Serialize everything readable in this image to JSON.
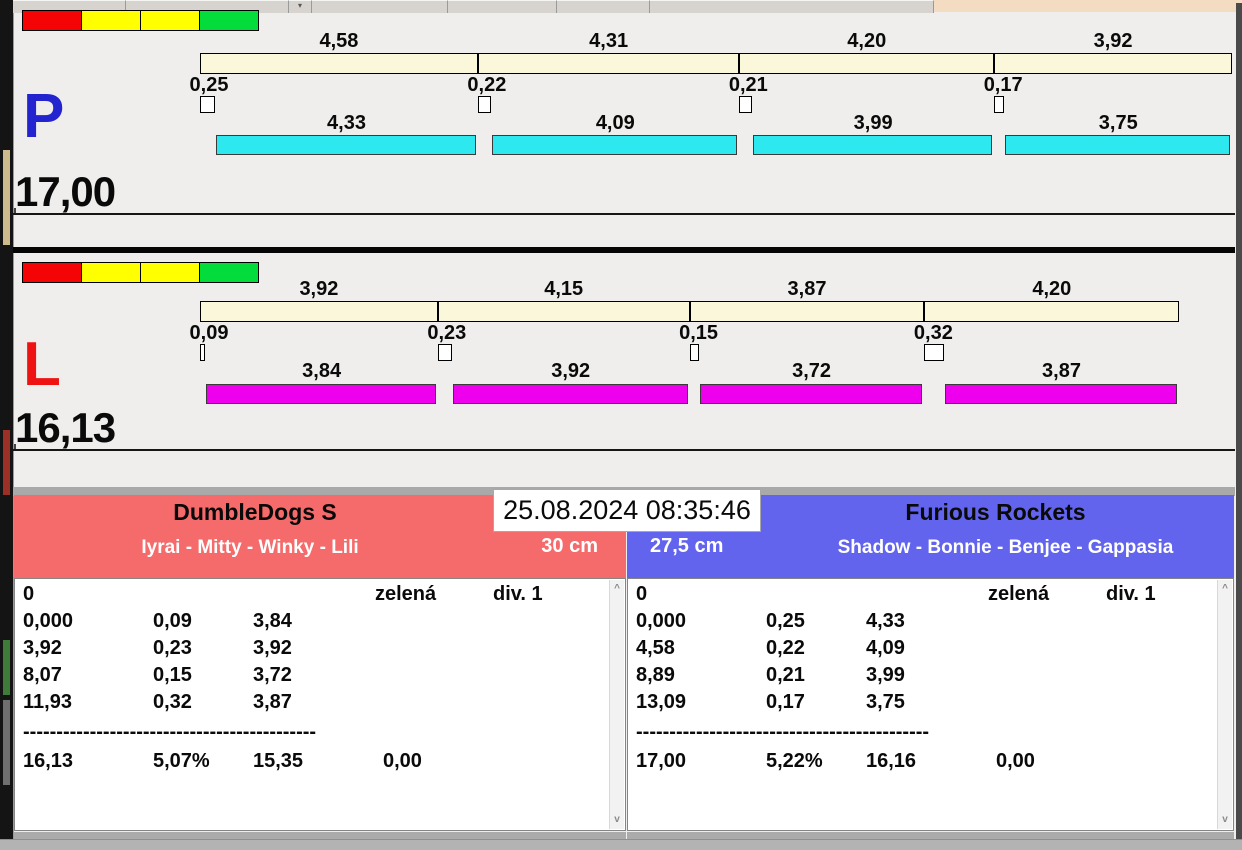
{
  "datetime": "25.08.2024 08:35:46",
  "runs": [
    {
      "letter": "P",
      "letter_color": "#2323cf",
      "total_label": "17,00",
      "total_seconds": 17.0,
      "bar_color": "#2de9ef",
      "legend_colors": [
        "#f40404",
        "#ffff00",
        "#ffff00",
        "#04dc3c"
      ],
      "laps": [
        {
          "split_label": "4,58",
          "split": 4.58,
          "box_label": "0,25",
          "box": 0.25,
          "net_label": "4,33",
          "net": 4.33
        },
        {
          "split_label": "4,31",
          "split": 4.31,
          "box_label": "0,22",
          "box": 0.22,
          "net_label": "4,09",
          "net": 4.09
        },
        {
          "split_label": "4,20",
          "split": 4.2,
          "box_label": "0,21",
          "box": 0.21,
          "net_label": "3,99",
          "net": 3.99
        },
        {
          "split_label": "3,92",
          "split": 3.92,
          "box_label": "0,17",
          "box": 0.17,
          "net_label": "3,75",
          "net": 3.75
        }
      ]
    },
    {
      "letter": "L",
      "letter_color": "#ee1212",
      "total_label": "16,13",
      "total_seconds": 16.13,
      "bar_color": "#ee00ee",
      "legend_colors": [
        "#f40404",
        "#ffff00",
        "#ffff00",
        "#04dc3c"
      ],
      "laps": [
        {
          "split_label": "3,92",
          "split": 3.92,
          "box_label": "0,09",
          "box": 0.09,
          "net_label": "3,84",
          "net": 3.84
        },
        {
          "split_label": "4,15",
          "split": 4.15,
          "box_label": "0,23",
          "box": 0.23,
          "net_label": "3,92",
          "net": 3.92
        },
        {
          "split_label": "3,87",
          "split": 3.87,
          "box_label": "0,15",
          "box": 0.15,
          "net_label": "3,72",
          "net": 3.72
        },
        {
          "split_label": "4,20",
          "split": 4.2,
          "box_label": "0,32",
          "box": 0.32,
          "net_label": "3,87",
          "net": 3.87
        }
      ]
    }
  ],
  "teams": [
    {
      "name": "DumbleDogs S",
      "dogs": "Iyrai - Mitty - Winky - Lili",
      "height": "30 cm",
      "header_color": "#f56a6a",
      "table": {
        "flags": "0",
        "lane_color": "zelená",
        "division": "div. 1",
        "rows": [
          [
            "0,000",
            "0,09",
            "3,84"
          ],
          [
            "3,92",
            "0,23",
            "3,92"
          ],
          [
            "8,07",
            "0,15",
            "3,72"
          ],
          [
            "11,93",
            "0,32",
            "3,87"
          ]
        ],
        "separator": "--------------------------------------------",
        "summary": [
          "16,13",
          "5,07%",
          "15,35",
          "0,00"
        ]
      }
    },
    {
      "name": "Furious Rockets",
      "dogs": "Shadow - Bonnie - Benjee - Gappasia",
      "height": "27,5 cm",
      "header_color": "#6264ee",
      "table": {
        "flags": "0",
        "lane_color": "zelená",
        "division": "div. 1",
        "rows": [
          [
            "0,000",
            "0,25",
            "4,33"
          ],
          [
            "4,58",
            "0,22",
            "4,09"
          ],
          [
            "8,89",
            "0,21",
            "3,99"
          ],
          [
            "13,09",
            "0,17",
            "3,75"
          ]
        ],
        "separator": "--------------------------------------------",
        "summary": [
          "17,00",
          "5,22%",
          "16,16",
          "0,00"
        ]
      }
    }
  ],
  "scrollbar": {
    "up": "^",
    "down": "v"
  }
}
